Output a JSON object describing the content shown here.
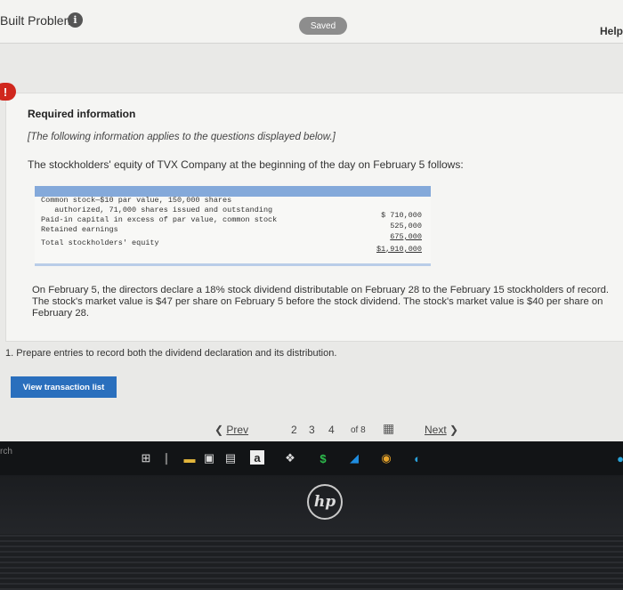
{
  "header": {
    "title": "Built Problems",
    "info_icon": "info-icon",
    "status": "Saved",
    "help": "Help"
  },
  "required_info": {
    "alert_glyph": "!",
    "title": "Required information",
    "note": "[The following information applies to the questions displayed below.]",
    "intro": "The stockholders' equity of TVX Company at the beginning of the day on February 5 follows:",
    "table": {
      "lines": [
        "Common stock—$10 par value, 150,000 shares",
        "   authorized, 71,000 shares issued and outstanding",
        "Paid-in capital in excess of par value, common stock",
        "Retained earnings",
        "Total stockholders' equity"
      ],
      "values": [
        "$ 710,000",
        "525,000",
        "675,000",
        "$1,910,000"
      ]
    },
    "paragraph": "On February 5, the directors declare a 18% stock dividend distributable on February 28 to the February 15 stockholders of record. The stock's market value is $47 per share on February 5 before the stock dividend. The stock's market value is $40 per share on February 28."
  },
  "question": "1. Prepare entries to record both the dividend declaration and its distribution.",
  "buttons": {
    "view_transaction_list": "View transaction list"
  },
  "pager": {
    "prev": "Prev",
    "pages": [
      "2",
      "3",
      "4"
    ],
    "of_label": "of 8",
    "next": "Next"
  },
  "taskbar": {
    "search_partial": "rch",
    "icons": [
      "task-view-icon",
      "file-explorer-icon",
      "store-icon",
      "amazon-icon",
      "dropbox-icon",
      "money-icon",
      "folder-icon",
      "chrome-icon",
      "edge-icon"
    ]
  },
  "device": {
    "logo": "hp"
  }
}
